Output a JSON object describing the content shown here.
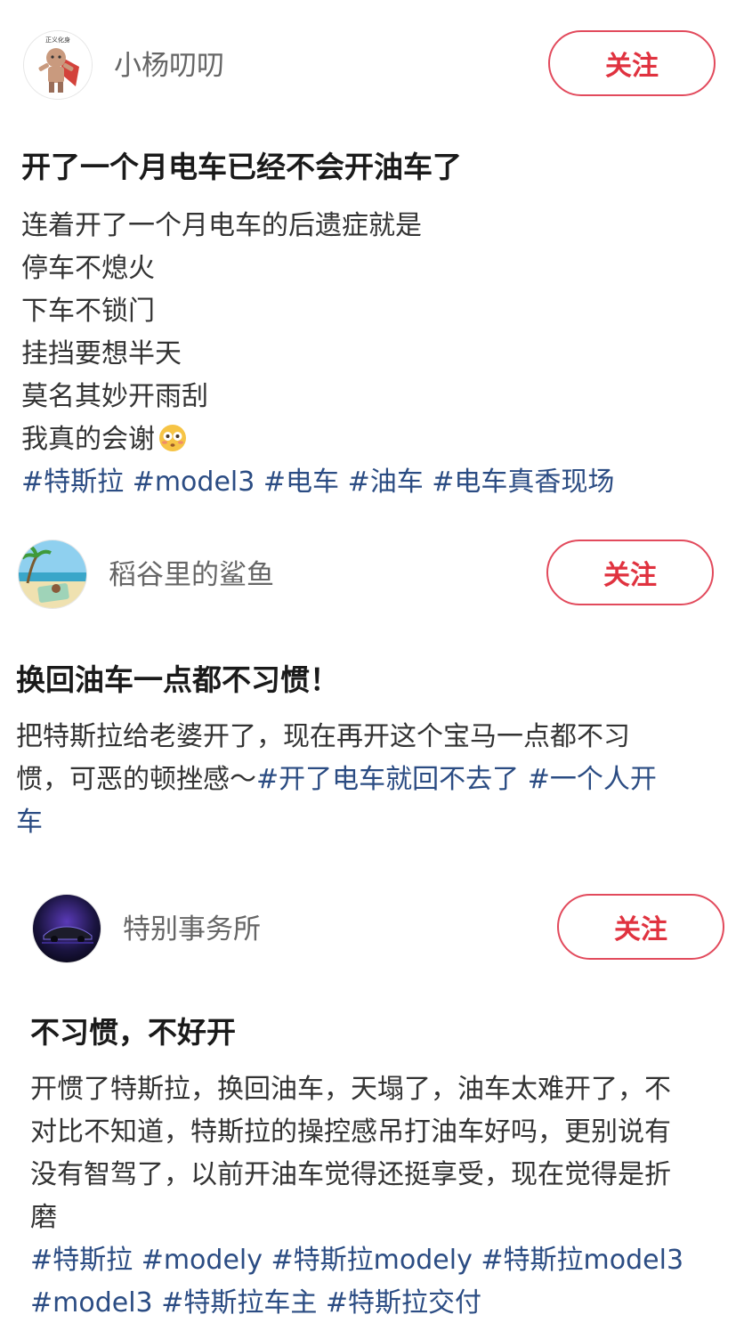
{
  "posts": [
    {
      "username": "小杨叨叨",
      "avatar_icon": "superhero-cartoon-avatar",
      "avatar_badge": "正义化身",
      "follow_label": "关注",
      "title": "开了一个月电车已经不会开油车了",
      "lines": [
        "连着开了一个月电车的后遗症就是",
        "停车不熄火",
        "下车不锁门",
        "挂挡要想半天",
        "莫名其妙开雨刮",
        "我真的会谢"
      ],
      "emoji": "flushed-face-emoji",
      "tags": [
        "#特斯拉",
        "#model3",
        "#电车",
        "#油车",
        "#电车真香现场"
      ]
    },
    {
      "username": "稻谷里的鲨鱼",
      "avatar_icon": "beach-palm-avatar",
      "follow_label": "关注",
      "title": "换回油车一点都不习惯！",
      "line1": "把特斯拉给老婆开了，现在再开这个宝马一点都不习",
      "line2_text": "惯，可恶的顿挫感～",
      "tags": [
        "#开了电车就回不去了",
        "#一个人开车"
      ]
    },
    {
      "username": "特别事务所",
      "avatar_icon": "dark-car-avatar",
      "follow_label": "关注",
      "title": "不习惯，不好开",
      "lines": [
        "开惯了特斯拉，换回油车，天塌了，油车太难开了，不",
        "对比不知道，特斯拉的操控感吊打油车好吗，更别说有",
        "没有智驾了，以前开油车觉得还挺享受，现在觉得是折",
        "磨"
      ],
      "tags": [
        "#特斯拉",
        "#modely",
        "#特斯拉modely",
        "#特斯拉model3",
        "#model3",
        "#特斯拉车主",
        "#特斯拉交付"
      ]
    }
  ],
  "colors": {
    "accent": "#e0323f",
    "tag": "#2b4c83"
  }
}
